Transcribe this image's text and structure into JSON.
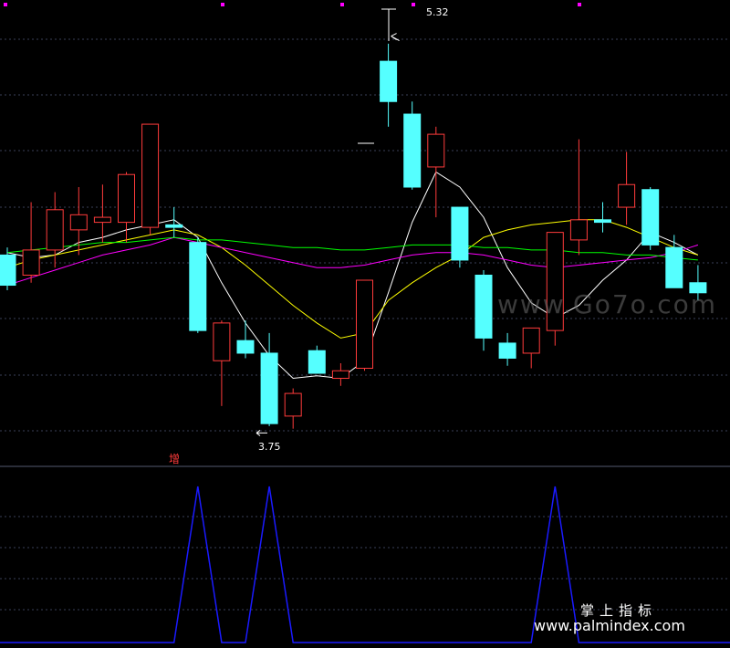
{
  "chart_data": {
    "type": "candlestick",
    "colors": {
      "background": "#000000",
      "grid": "#3a3f58",
      "up": "#ff3b3b",
      "down": "#55ffff",
      "ma5": "#ffffff",
      "ma10": "#ffff00",
      "ma20": "#ff00ff",
      "ma60": "#00ff00",
      "indicator": "#1a1aff",
      "dot": "#ff00ff",
      "signal_text": "#ff3b3b",
      "label_text": "#ffffff"
    },
    "price_range": [
      3.65,
      5.42
    ],
    "candles": [
      {
        "o": 4.45,
        "h": 4.48,
        "l": 4.31,
        "c": 4.33
      },
      {
        "o": 4.37,
        "h": 4.66,
        "l": 4.34,
        "c": 4.47
      },
      {
        "o": 4.47,
        "h": 4.7,
        "l": 4.4,
        "c": 4.63
      },
      {
        "o": 4.55,
        "h": 4.72,
        "l": 4.45,
        "c": 4.61
      },
      {
        "o": 4.58,
        "h": 4.73,
        "l": 4.5,
        "c": 4.6
      },
      {
        "o": 4.58,
        "h": 4.78,
        "l": 4.5,
        "c": 4.77
      },
      {
        "o": 4.56,
        "h": 4.78,
        "l": 4.53,
        "c": 4.97
      },
      {
        "o": 4.57,
        "h": 4.64,
        "l": 4.52,
        "c": 4.56
      },
      {
        "o": 4.5,
        "h": 4.52,
        "l": 4.14,
        "c": 4.15
      },
      {
        "o": 4.03,
        "h": 4.19,
        "l": 3.85,
        "c": 4.18
      },
      {
        "o": 4.11,
        "h": 4.19,
        "l": 4.04,
        "c": 4.06
      },
      {
        "o": 4.06,
        "h": 4.14,
        "l": 3.77,
        "c": 3.78
      },
      {
        "o": 3.81,
        "h": 3.92,
        "l": 3.76,
        "c": 3.9
      },
      {
        "o": 4.07,
        "h": 4.09,
        "l": 4.02,
        "c": 3.98
      },
      {
        "o": 3.96,
        "h": 4.02,
        "l": 3.93,
        "c": 3.99
      },
      {
        "o": 4.0,
        "h": 4.35,
        "l": 3.99,
        "c": 4.35
      },
      {
        "o": 5.22,
        "h": 5.29,
        "l": 4.96,
        "c": 5.06
      },
      {
        "o": 5.01,
        "h": 5.06,
        "l": 4.71,
        "c": 4.72
      },
      {
        "o": 4.8,
        "h": 4.96,
        "l": 4.6,
        "c": 4.93
      },
      {
        "o": 4.64,
        "h": 4.64,
        "l": 4.4,
        "c": 4.43
      },
      {
        "o": 4.37,
        "h": 4.39,
        "l": 4.07,
        "c": 4.12
      },
      {
        "o": 4.1,
        "h": 4.14,
        "l": 4.01,
        "c": 4.04
      },
      {
        "o": 4.06,
        "h": 4.09,
        "l": 4.0,
        "c": 4.16
      },
      {
        "o": 4.15,
        "h": 4.47,
        "l": 4.09,
        "c": 4.54
      },
      {
        "o": 4.51,
        "h": 4.91,
        "l": 4.45,
        "c": 4.59
      },
      {
        "o": 4.59,
        "h": 4.66,
        "l": 4.54,
        "c": 4.58
      },
      {
        "o": 4.64,
        "h": 4.86,
        "l": 4.57,
        "c": 4.73
      },
      {
        "o": 4.71,
        "h": 4.72,
        "l": 4.47,
        "c": 4.49
      },
      {
        "o": 4.48,
        "h": 4.53,
        "l": 4.34,
        "c": 4.32
      },
      {
        "o": 4.34,
        "h": 4.41,
        "l": 4.27,
        "c": 4.3
      }
    ],
    "ma_lines": [
      {
        "name": "MA5",
        "color_key": "ma5",
        "values": [
          4.46,
          4.44,
          4.45,
          4.5,
          4.52,
          4.55,
          4.57,
          4.59,
          4.52,
          4.34,
          4.18,
          4.05,
          3.96,
          3.97,
          3.96,
          4.03,
          4.3,
          4.58,
          4.78,
          4.72,
          4.6,
          4.4,
          4.26,
          4.2,
          4.25,
          4.35,
          4.43,
          4.54,
          4.5,
          4.45
        ]
      },
      {
        "name": "MA10",
        "color_key": "ma10",
        "values": [
          4.4,
          4.43,
          4.45,
          4.47,
          4.49,
          4.51,
          4.53,
          4.55,
          4.53,
          4.48,
          4.41,
          4.33,
          4.25,
          4.18,
          4.12,
          4.14,
          4.27,
          4.34,
          4.4,
          4.45,
          4.52,
          4.55,
          4.57,
          4.58,
          4.59,
          4.59,
          4.56,
          4.52,
          4.48,
          4.45
        ]
      },
      {
        "name": "MA20",
        "color_key": "ma20",
        "values": [
          4.33,
          4.36,
          4.39,
          4.42,
          4.45,
          4.47,
          4.49,
          4.52,
          4.5,
          4.48,
          4.46,
          4.44,
          4.42,
          4.4,
          4.4,
          4.41,
          4.43,
          4.45,
          4.46,
          4.46,
          4.45,
          4.43,
          4.41,
          4.4,
          4.41,
          4.42,
          4.43,
          4.44,
          4.46,
          4.49
        ]
      },
      {
        "name": "MA60",
        "color_key": "ma60",
        "values": [
          4.46,
          4.47,
          4.48,
          4.49,
          4.5,
          4.5,
          4.51,
          4.52,
          4.51,
          4.51,
          4.5,
          4.49,
          4.48,
          4.48,
          4.47,
          4.47,
          4.48,
          4.49,
          4.49,
          4.49,
          4.48,
          4.48,
          4.47,
          4.47,
          4.46,
          4.46,
          4.45,
          4.45,
          4.44,
          4.43
        ]
      }
    ],
    "annotations": {
      "high_label": "5.32",
      "high_value": 5.32,
      "high_candle_index": 16,
      "low_label": "3.75",
      "low_value": 3.75,
      "low_candle_index": 10,
      "signal_text": "增",
      "signal_candle_index": 6
    },
    "indicator": {
      "range": [
        0,
        1
      ],
      "values": [
        0,
        0,
        0,
        0,
        0,
        0,
        0,
        0,
        1,
        0,
        0,
        1,
        0,
        0,
        0,
        0,
        0,
        0,
        0,
        0,
        0,
        0,
        0,
        1,
        0,
        0,
        0,
        0,
        0,
        0
      ]
    },
    "grid": true
  },
  "watermarks": {
    "center_url": "www.Go7o.com",
    "bottom_title": "掌上指标",
    "bottom_url": "www.palmindex.com"
  }
}
